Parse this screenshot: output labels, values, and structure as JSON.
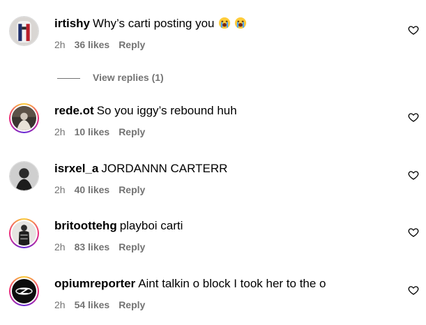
{
  "comments": [
    {
      "username": "irtishy",
      "text": "Why’s carti posting you",
      "emojis": [
        "loudly-crying-face-emoji",
        "loudly-crying-face-emoji"
      ],
      "time": "2h",
      "likes": "36 likes",
      "reply": "Reply",
      "story_ring": false
    },
    {
      "username": "rede.ot",
      "text": "So you iggy’s rebound huh",
      "time": "2h",
      "likes": "10 likes",
      "reply": "Reply",
      "story_ring": true
    },
    {
      "username": "isrxel_a",
      "text": "JORDANNN CARTERR",
      "time": "2h",
      "likes": "40 likes",
      "reply": "Reply",
      "story_ring": false
    },
    {
      "username": "britoottehg",
      "text": "playboi carti",
      "time": "2h",
      "likes": "83 likes",
      "reply": "Reply",
      "story_ring": true
    },
    {
      "username": "opiumreporter",
      "text": "Aint talkin o block I took her to the o",
      "time": "2h",
      "likes": "54 likes",
      "reply": "Reply",
      "story_ring": true
    }
  ],
  "view_replies": "View replies (1)",
  "colors": {
    "meta_gray": "#737373",
    "story_ring": [
      "#f9ce34",
      "#ee2a7b",
      "#6228d7"
    ]
  },
  "icons": {
    "like": "heart-outline-icon"
  }
}
